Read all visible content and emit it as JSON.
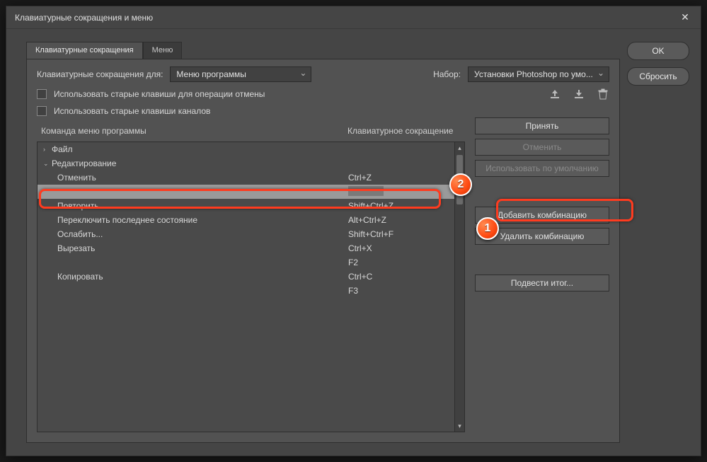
{
  "title": "Клавиатурные сокращения и меню",
  "side_buttons": {
    "ok": "OK",
    "reset": "Сбросить"
  },
  "tabs": {
    "shortcuts": "Клавиатурные сокращения",
    "menus": "Меню"
  },
  "labels": {
    "shortcuts_for": "Клавиатурные сокращения для:",
    "set": "Набор:",
    "use_old_undo": "Использовать старые клавиши для операции отмены",
    "use_old_channels": "Использовать старые клавиши каналов",
    "col_command": "Команда меню программы",
    "col_shortcut": "Клавиатурное сокращение"
  },
  "dropdowns": {
    "shortcuts_for_value": "Меню программы",
    "set_value": "Установки Photoshop по умо..."
  },
  "list": {
    "groups": [
      {
        "name": "Файл",
        "expanded": false
      },
      {
        "name": "Редактирование",
        "expanded": true
      }
    ],
    "rows": [
      {
        "cmd": "Отменить",
        "short": "Ctrl+Z"
      },
      {
        "cmd": "",
        "short": "",
        "selected": true
      },
      {
        "cmd": "Повторить",
        "short": "Shift+Ctrl+Z"
      },
      {
        "cmd": "Переключить последнее состояние",
        "short": "Alt+Ctrl+Z"
      },
      {
        "cmd": "Ослабить...",
        "short": "Shift+Ctrl+F"
      },
      {
        "cmd": "Вырезать",
        "short": "Ctrl+X"
      },
      {
        "cmd": "",
        "short": "F2"
      },
      {
        "cmd": "Копировать",
        "short": "Ctrl+C"
      },
      {
        "cmd": "",
        "short": "F3"
      }
    ]
  },
  "action_buttons": {
    "accept": "Принять",
    "undo": "Отменить",
    "use_default": "Использовать по умолчанию",
    "add": "Добавить комбинацию",
    "delete": "Удалить комбинацию",
    "summarize": "Подвести итог..."
  },
  "callouts": {
    "one": "1",
    "two": "2"
  }
}
